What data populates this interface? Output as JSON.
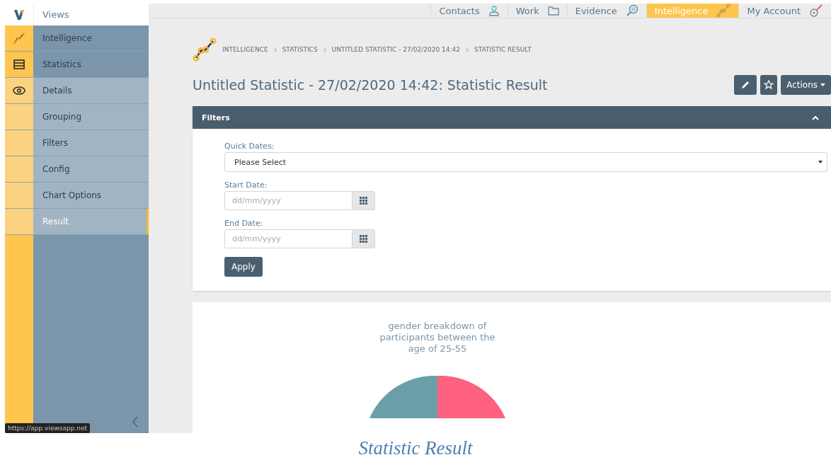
{
  "brand": {
    "name": "Views"
  },
  "top_nav": [
    {
      "label": "Contacts",
      "selected": false
    },
    {
      "label": "Work",
      "selected": false
    },
    {
      "label": "Evidence",
      "selected": false
    },
    {
      "label": "Intelligence",
      "selected": true
    },
    {
      "label": "My Account",
      "selected": false
    }
  ],
  "sidebar": {
    "items": [
      {
        "label": "Intelligence",
        "kind": "section",
        "selected": false
      },
      {
        "label": "Statistics",
        "kind": "section",
        "selected": false
      },
      {
        "label": "Details",
        "kind": "step",
        "selected": false
      },
      {
        "label": "Grouping",
        "kind": "step",
        "selected": false
      },
      {
        "label": "Filters",
        "kind": "step",
        "selected": false
      },
      {
        "label": "Config",
        "kind": "step",
        "selected": false
      },
      {
        "label": "Chart Options",
        "kind": "step",
        "selected": false
      },
      {
        "label": "Result",
        "kind": "step",
        "selected": true
      }
    ]
  },
  "breadcrumb": [
    "INTELLIGENCE",
    "STATISTICS",
    "UNTITLED STATISTIC - 27/02/2020 14:42",
    "STATISTIC RESULT"
  ],
  "page_title": "Untitled Statistic - 27/02/2020 14:42: Statistic Result",
  "actions_button": "Actions",
  "filters": {
    "title": "Filters",
    "expanded": true,
    "quick_dates": {
      "label": "Quick Dates:",
      "value": "Please Select"
    },
    "start_date": {
      "label": "Start Date:",
      "placeholder": "dd/mm/yyyy"
    },
    "end_date": {
      "label": "End Date:",
      "placeholder": "dd/mm/yyyy"
    },
    "apply_button": "Apply"
  },
  "chart": {
    "title": "gender breakdown of participants between the age of 25-55"
  },
  "status_tooltip": "https://app.viewsapp.net",
  "caption": "Statistic Result"
}
